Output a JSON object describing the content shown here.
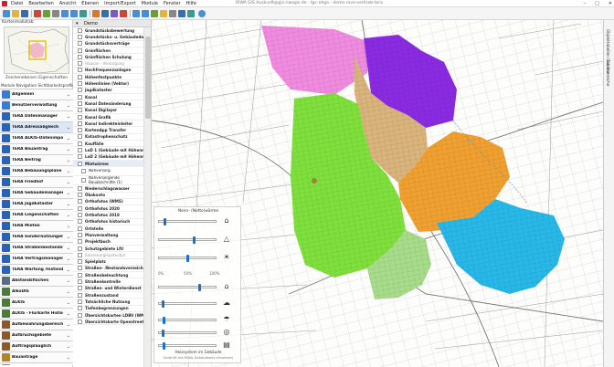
{
  "window": {
    "title": "RIWA GIS Auskunft@gis.riwagis.de - tgc-ohga - demo-rove-vertrieb-tera",
    "controls": [
      "–",
      "□",
      "✕"
    ]
  },
  "menu": [
    "Datei",
    "Bearbeiten",
    "Ansicht",
    "Ebenen",
    "Import/Export",
    "Module",
    "Fenster",
    "Hilfe"
  ],
  "overview": {
    "title": "Kartenmaßstab",
    "caption": "Zeichenebenen Eigenschaften",
    "tabs": "Module  Navigation  Sichtbarkeitsprofile"
  },
  "modules": [
    {
      "label": "Allgemein",
      "color": "#3a7bd5"
    },
    {
      "label": "Benutzerverwaltung",
      "color": "#3a7bd5"
    },
    {
      "label": "TERA Datenmanager",
      "color": "#2a62b8"
    },
    {
      "label": "TERA Adressabgleich",
      "color": "#2a62b8"
    },
    {
      "label": "TERA ALKIS-Datenimport",
      "color": "#2a62b8"
    },
    {
      "label": "TERA Bauantrag",
      "color": "#2a62b8"
    },
    {
      "label": "TERA Beitrag",
      "color": "#2a62b8"
    },
    {
      "label": "TERA Bebauungspläne",
      "color": "#2a62b8"
    },
    {
      "label": "TERA Friedhof",
      "color": "#2a62b8"
    },
    {
      "label": "TERA Gebäudemanager",
      "color": "#2a62b8"
    },
    {
      "label": "TERA Jagdkataster",
      "color": "#2a62b8"
    },
    {
      "label": "TERA Liegenschaften",
      "color": "#2a62b8"
    },
    {
      "label": "TERA Mieten",
      "color": "#2a62b8"
    },
    {
      "label": "TERA Sondernutzungen",
      "color": "#2a62b8"
    },
    {
      "label": "TERA Straßenbestandsverz.",
      "color": "#2a62b8"
    },
    {
      "label": "TERA Vertragsmanager",
      "color": "#2a62b8"
    },
    {
      "label": "TERA Wartung /Instandha...",
      "color": "#2a62b8"
    },
    {
      "label": "Abstandsflächen",
      "color": "#5a6c7e"
    },
    {
      "label": "AlkoDIS",
      "color": "#4b7a3a"
    },
    {
      "label": "ALKIS",
      "color": "#4b7a3a"
    },
    {
      "label": "ALKIS - Flurkarte Historisch",
      "color": "#4b7a3a"
    },
    {
      "label": "Aufbewahrungsbereiche",
      "color": "#8a5a2a"
    },
    {
      "label": "Aufbruchsgebiete",
      "color": "#8a5a2a"
    },
    {
      "label": "Auftragsplauglich",
      "color": "#8a5a2a"
    },
    {
      "label": "Bauanträge",
      "color": "#b3822b"
    },
    {
      "label": "Bauantragverwaltung",
      "color": "#b3822b"
    }
  ],
  "layers_panel": {
    "title": "Demo"
  },
  "layers": [
    {
      "label": "Grundstücksbewertung",
      "style": ""
    },
    {
      "label": "Grundstücks- u. Gebäudedaten",
      "style": ""
    },
    {
      "label": "Grundstücksverträge",
      "style": ""
    },
    {
      "label": "Grünflächen",
      "style": ""
    },
    {
      "label": "Grünflächen Schulung",
      "style": ""
    },
    {
      "label": "Hausan - Versorgung",
      "style": "grey"
    },
    {
      "label": "Hochfrequenzanlagen",
      "style": ""
    },
    {
      "label": "Höhenfestpunkte",
      "style": ""
    },
    {
      "label": "Höhenlinien (Vektor)",
      "style": ""
    },
    {
      "label": "Jagdkataster",
      "style": ""
    },
    {
      "label": "Kanal",
      "style": ""
    },
    {
      "label": "Kanal Datenänderung",
      "style": ""
    },
    {
      "label": "Kanal Digilayer",
      "style": ""
    },
    {
      "label": "Kanal Grafik",
      "style": ""
    },
    {
      "label": "Kanal Indirekteinleiter",
      "style": ""
    },
    {
      "label": "KartenApp Transfer",
      "style": ""
    },
    {
      "label": "Katastrophenschutz",
      "style": ""
    },
    {
      "label": "Kauffälle",
      "style": ""
    },
    {
      "label": "LoD 1 (Gebäude mit Höhenmod.)",
      "style": ""
    },
    {
      "label": "LoD 2 (Gebäude mit Höhenmod.)",
      "style": ""
    },
    {
      "label": "Mietwärme",
      "style": "sel"
    },
    {
      "label": "Nahversorg.",
      "style": "sub"
    },
    {
      "label": "Nahversorgende Bauabschnitte (1)",
      "style": "sub"
    },
    {
      "label": "Niederschlagswasser",
      "style": ""
    },
    {
      "label": "Ökokonto",
      "style": ""
    },
    {
      "label": "Orthofotos (WMS)",
      "style": ""
    },
    {
      "label": "Orthofotos 2020",
      "style": ""
    },
    {
      "label": "Orthofotos 2018",
      "style": ""
    },
    {
      "label": "Orthofotos historisch",
      "style": ""
    },
    {
      "label": "Ortsteile",
      "style": ""
    },
    {
      "label": "Planverwaltung",
      "style": ""
    },
    {
      "label": "Projektbuch",
      "style": ""
    },
    {
      "label": "Schutzgebiete LfU",
      "style": ""
    },
    {
      "label": "Solarenergiepotential",
      "style": "grey"
    },
    {
      "label": "Spielplatz",
      "style": ""
    },
    {
      "label": "Straßen- /Bestandsverzeichnis",
      "style": ""
    },
    {
      "label": "Straßenbeleuchtung",
      "style": ""
    },
    {
      "label": "Straßenkontrolle",
      "style": ""
    },
    {
      "label": "Straßen- und Winterdienst",
      "style": ""
    },
    {
      "label": "Straßenzustand",
      "style": ""
    },
    {
      "label": "Tatsächliche Nutzung",
      "style": ""
    },
    {
      "label": "Tiefenbegrenzungen",
      "style": ""
    },
    {
      "label": "Übersichtskarten LDBV (WMS)",
      "style": ""
    },
    {
      "label": "Übersichtskarte Openstreetmap",
      "style": ""
    }
  ],
  "transparency": {
    "title": "Nenn- (Netto)wärme",
    "pct_left": "0%",
    "pct_mid": "50%",
    "pct_right": "100%",
    "footer": "Heizsystem im Gebäude",
    "footer2": "Gerdrüft mit RIWA-Gebäudemix einsetzen)",
    "slider_values": [
      0.08,
      0.61,
      0.5,
      0.71,
      0.05,
      0.06,
      0.05,
      0.07,
      0.06
    ]
  },
  "right_tabs": [
    "Objekttabellen Gebiete",
    "Suchbereiche"
  ],
  "map_colors": {
    "pink": "#f08be0",
    "purple": "#8a2be2",
    "tan": "#d9b47c",
    "green": "#7fe03c",
    "lightgreen": "#a8dc8a",
    "orange": "#f0a030",
    "cyan": "#28b8e8"
  }
}
